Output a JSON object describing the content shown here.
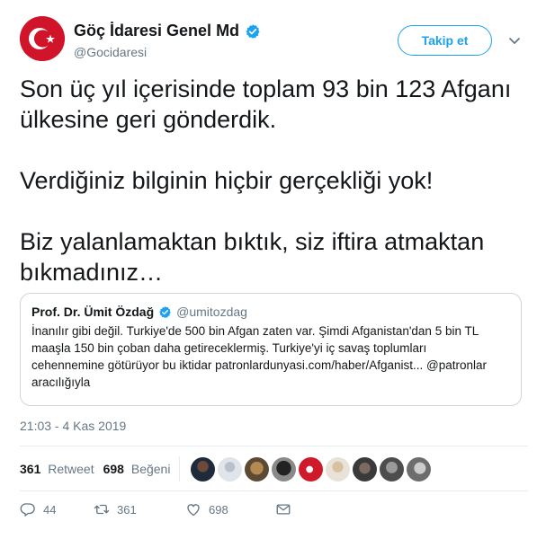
{
  "tweet": {
    "display_name": "Göç İdaresi Genel Md",
    "handle": "@Gocidaresi",
    "follow_label": "Takip et",
    "text_lines": [
      "Son üç yıl içerisinde toplam 93 bin 123 Afganı",
      "ülkesine geri gönderdik.",
      "Verdiğiniz bilginin hiçbir gerçekliği yok!",
      "Biz yalanlamaktan bıktık, siz iftira atmaktan",
      "bıkmadınız…"
    ],
    "timestamp": "21:03 - 4 Kas 2019"
  },
  "quote": {
    "name": "Prof. Dr. Ümit Özdağ",
    "handle": "@umitozdag",
    "body_lines": [
      "İnanılır gibi değil. Turkiye'de 500 bin Afgan zaten var. Şimdi Afganistan'dan 5 bin TL",
      "maaşla 150 bin çoban daha getireceklermiş. Turkiye'yi iç savaş toplumları",
      "cehennemine götürüyor bu iktidar  patronlardunyasi.com/haber/Afganist... @patronlar",
      "aracılığıyla"
    ]
  },
  "stats": {
    "retweet_count": "361",
    "retweet_label": "Retweet",
    "like_count": "698",
    "like_label": "Beğeni"
  },
  "actions": {
    "reply_count": "44",
    "retweet_count": "361",
    "like_count": "698"
  },
  "icons": {
    "verified": "verified-badge-icon",
    "caret": "chevron-down-icon",
    "reply": "reply-icon",
    "retweet": "retweet-icon",
    "like": "heart-icon",
    "message": "direct-message-icon"
  },
  "colors": {
    "accent": "#1da1f2",
    "logo_red": "#d0142a",
    "muted": "#657786",
    "border": "#ccd6dd"
  }
}
